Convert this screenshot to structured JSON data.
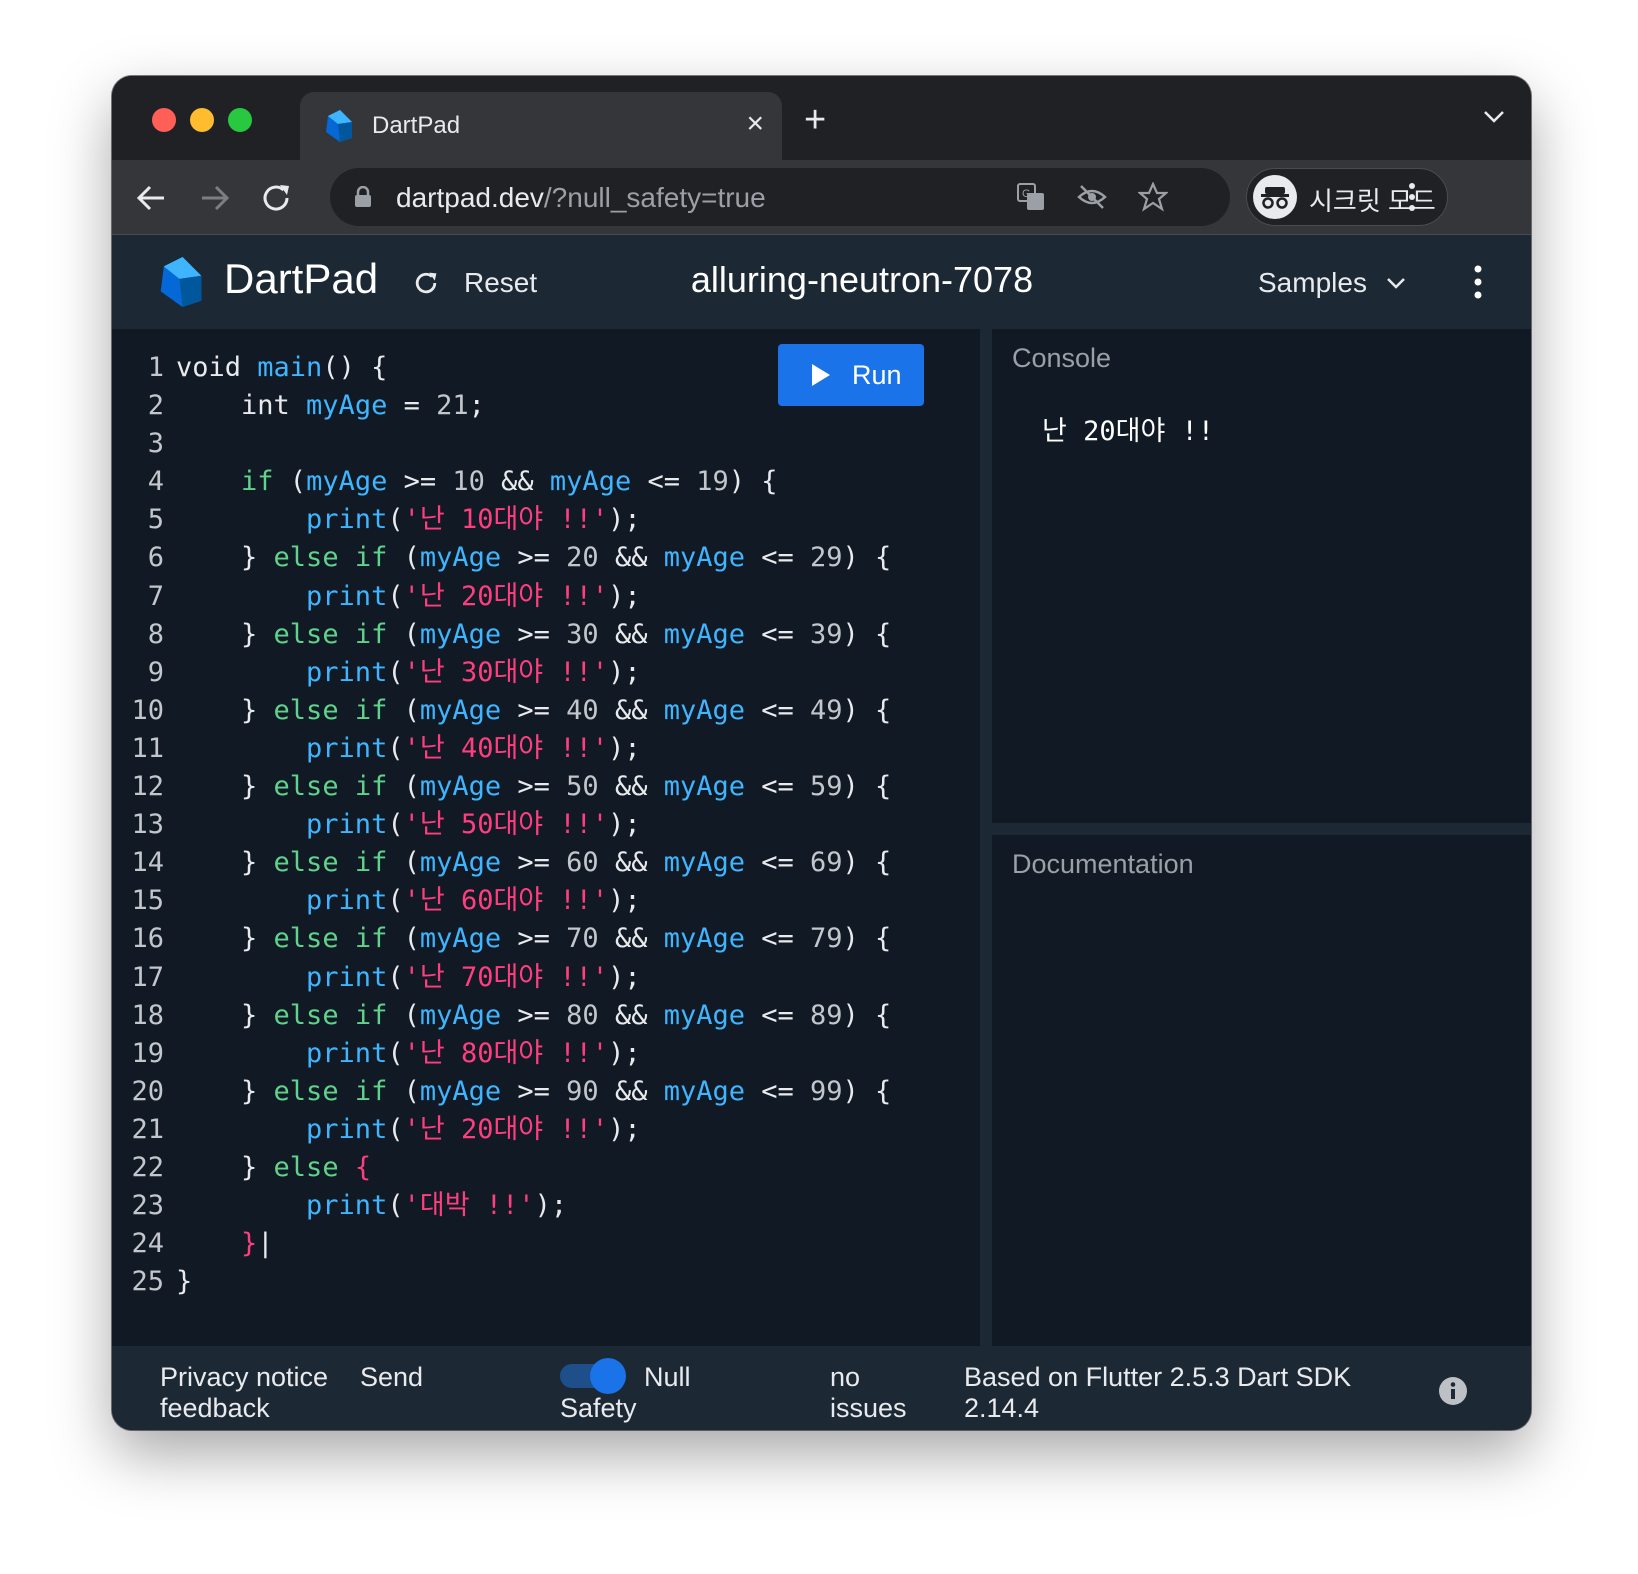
{
  "browser": {
    "tab_title": "DartPad",
    "tab_close": "×",
    "new_tab": "+",
    "url_host": "dartpad.dev",
    "url_rest": "/?null_safety=true",
    "incognito_label": "시크릿 모드"
  },
  "app": {
    "title": "DartPad",
    "reset_label": "Reset",
    "snippet_name": "alluring-neutron-7078",
    "samples_label": "Samples",
    "run_label": "Run"
  },
  "editor": {
    "lines": [
      {
        "n": "1",
        "segs": [
          [
            "",
            "void "
          ],
          [
            "fn",
            "main"
          ],
          [
            "",
            "() {"
          ]
        ]
      },
      {
        "n": "2",
        "segs": [
          [
            "",
            "    int "
          ],
          [
            "fn",
            "myAge"
          ],
          [
            "",
            " = "
          ],
          [
            "num",
            "21"
          ],
          [
            "",
            ";"
          ]
        ]
      },
      {
        "n": "3",
        "segs": []
      },
      {
        "n": "4",
        "segs": [
          [
            "kw",
            "    if"
          ],
          [
            "",
            " ("
          ],
          [
            "fn",
            "myAge"
          ],
          [
            "",
            " >= "
          ],
          [
            "num",
            "10"
          ],
          [
            "",
            " && "
          ],
          [
            "fn",
            "myAge"
          ],
          [
            "",
            " <= "
          ],
          [
            "num",
            "19"
          ],
          [
            "",
            ") {"
          ]
        ]
      },
      {
        "n": "5",
        "segs": [
          [
            "fn",
            "        print"
          ],
          [
            "",
            "("
          ],
          [
            "str",
            "'난 10대야 !!'"
          ],
          [
            "",
            ");"
          ]
        ]
      },
      {
        "n": "6",
        "segs": [
          [
            "",
            "    } "
          ],
          [
            "kw",
            "else if"
          ],
          [
            "",
            " ("
          ],
          [
            "fn",
            "myAge"
          ],
          [
            "",
            " >= "
          ],
          [
            "num",
            "20"
          ],
          [
            "",
            " && "
          ],
          [
            "fn",
            "myAge"
          ],
          [
            "",
            " <= "
          ],
          [
            "num",
            "29"
          ],
          [
            "",
            ") {"
          ]
        ]
      },
      {
        "n": "7",
        "segs": [
          [
            "fn",
            "        print"
          ],
          [
            "",
            "("
          ],
          [
            "str",
            "'난 20대야 !!'"
          ],
          [
            "",
            ");"
          ]
        ]
      },
      {
        "n": "8",
        "segs": [
          [
            "",
            "    } "
          ],
          [
            "kw",
            "else if"
          ],
          [
            "",
            " ("
          ],
          [
            "fn",
            "myAge"
          ],
          [
            "",
            " >= "
          ],
          [
            "num",
            "30"
          ],
          [
            "",
            " && "
          ],
          [
            "fn",
            "myAge"
          ],
          [
            "",
            " <= "
          ],
          [
            "num",
            "39"
          ],
          [
            "",
            ") {"
          ]
        ]
      },
      {
        "n": "9",
        "segs": [
          [
            "fn",
            "        print"
          ],
          [
            "",
            "("
          ],
          [
            "str",
            "'난 30대야 !!'"
          ],
          [
            "",
            ");"
          ]
        ]
      },
      {
        "n": "10",
        "segs": [
          [
            "",
            "    } "
          ],
          [
            "kw",
            "else if"
          ],
          [
            "",
            " ("
          ],
          [
            "fn",
            "myAge"
          ],
          [
            "",
            " >= "
          ],
          [
            "num",
            "40"
          ],
          [
            "",
            " && "
          ],
          [
            "fn",
            "myAge"
          ],
          [
            "",
            " <= "
          ],
          [
            "num",
            "49"
          ],
          [
            "",
            ") {"
          ]
        ]
      },
      {
        "n": "11",
        "segs": [
          [
            "fn",
            "        print"
          ],
          [
            "",
            "("
          ],
          [
            "str",
            "'난 40대야 !!'"
          ],
          [
            "",
            ");"
          ]
        ]
      },
      {
        "n": "12",
        "segs": [
          [
            "",
            "    } "
          ],
          [
            "kw",
            "else if"
          ],
          [
            "",
            " ("
          ],
          [
            "fn",
            "myAge"
          ],
          [
            "",
            " >= "
          ],
          [
            "num",
            "50"
          ],
          [
            "",
            " && "
          ],
          [
            "fn",
            "myAge"
          ],
          [
            "",
            " <= "
          ],
          [
            "num",
            "59"
          ],
          [
            "",
            ") {"
          ]
        ]
      },
      {
        "n": "13",
        "segs": [
          [
            "fn",
            "        print"
          ],
          [
            "",
            "("
          ],
          [
            "str",
            "'난 50대야 !!'"
          ],
          [
            "",
            ");"
          ]
        ]
      },
      {
        "n": "14",
        "segs": [
          [
            "",
            "    } "
          ],
          [
            "kw",
            "else if"
          ],
          [
            "",
            " ("
          ],
          [
            "fn",
            "myAge"
          ],
          [
            "",
            " >= "
          ],
          [
            "num",
            "60"
          ],
          [
            "",
            " && "
          ],
          [
            "fn",
            "myAge"
          ],
          [
            "",
            " <= "
          ],
          [
            "num",
            "69"
          ],
          [
            "",
            ") {"
          ]
        ]
      },
      {
        "n": "15",
        "segs": [
          [
            "fn",
            "        print"
          ],
          [
            "",
            "("
          ],
          [
            "str",
            "'난 60대야 !!'"
          ],
          [
            "",
            ");"
          ]
        ]
      },
      {
        "n": "16",
        "segs": [
          [
            "",
            "    } "
          ],
          [
            "kw",
            "else if"
          ],
          [
            "",
            " ("
          ],
          [
            "fn",
            "myAge"
          ],
          [
            "",
            " >= "
          ],
          [
            "num",
            "70"
          ],
          [
            "",
            " && "
          ],
          [
            "fn",
            "myAge"
          ],
          [
            "",
            " <= "
          ],
          [
            "num",
            "79"
          ],
          [
            "",
            ") {"
          ]
        ]
      },
      {
        "n": "17",
        "segs": [
          [
            "fn",
            "        print"
          ],
          [
            "",
            "("
          ],
          [
            "str",
            "'난 70대야 !!'"
          ],
          [
            "",
            ");"
          ]
        ]
      },
      {
        "n": "18",
        "segs": [
          [
            "",
            "    } "
          ],
          [
            "kw",
            "else if"
          ],
          [
            "",
            " ("
          ],
          [
            "fn",
            "myAge"
          ],
          [
            "",
            " >= "
          ],
          [
            "num",
            "80"
          ],
          [
            "",
            " && "
          ],
          [
            "fn",
            "myAge"
          ],
          [
            "",
            " <= "
          ],
          [
            "num",
            "89"
          ],
          [
            "",
            ") {"
          ]
        ]
      },
      {
        "n": "19",
        "segs": [
          [
            "fn",
            "        print"
          ],
          [
            "",
            "("
          ],
          [
            "str",
            "'난 80대야 !!'"
          ],
          [
            "",
            ");"
          ]
        ]
      },
      {
        "n": "20",
        "segs": [
          [
            "",
            "    } "
          ],
          [
            "kw",
            "else if"
          ],
          [
            "",
            " ("
          ],
          [
            "fn",
            "myAge"
          ],
          [
            "",
            " >= "
          ],
          [
            "num",
            "90"
          ],
          [
            "",
            " && "
          ],
          [
            "fn",
            "myAge"
          ],
          [
            "",
            " <= "
          ],
          [
            "num",
            "99"
          ],
          [
            "",
            ") {"
          ]
        ]
      },
      {
        "n": "21",
        "segs": [
          [
            "fn",
            "        print"
          ],
          [
            "",
            "("
          ],
          [
            "str",
            "'난 20대야 !!'"
          ],
          [
            "",
            ");"
          ]
        ]
      },
      {
        "n": "22",
        "segs": [
          [
            "",
            "    } "
          ],
          [
            "kw",
            "else"
          ],
          [
            "",
            " "
          ],
          [
            "red",
            "{"
          ]
        ]
      },
      {
        "n": "23",
        "segs": [
          [
            "fn",
            "        print"
          ],
          [
            "",
            "("
          ],
          [
            "str",
            "'대박 !!'"
          ],
          [
            "",
            ");"
          ]
        ]
      },
      {
        "n": "24",
        "segs": [
          [
            "red",
            "    }"
          ],
          [
            "",
            "|"
          ]
        ]
      },
      {
        "n": "25",
        "segs": [
          [
            "",
            "}"
          ]
        ]
      }
    ]
  },
  "console": {
    "title": "Console",
    "output": "난 20대야 !!"
  },
  "documentation": {
    "title": "Documentation"
  },
  "footer": {
    "privacy_notice": "Privacy notice",
    "send_feedback_1": "Send",
    "send_feedback_2": "feedback",
    "null_safety_1": "Null",
    "null_safety_2": "Safety",
    "null_safety_on": true,
    "issues_1": "no",
    "issues_2": "issues",
    "version_1": "Based on Flutter 2.5.3 Dart SDK",
    "version_2": "2.14.4"
  },
  "colors": {
    "keyword": "#5fd38b",
    "identifier": "#3fb5ff",
    "string": "#ff3e7f",
    "accent": "#1a73e8"
  }
}
